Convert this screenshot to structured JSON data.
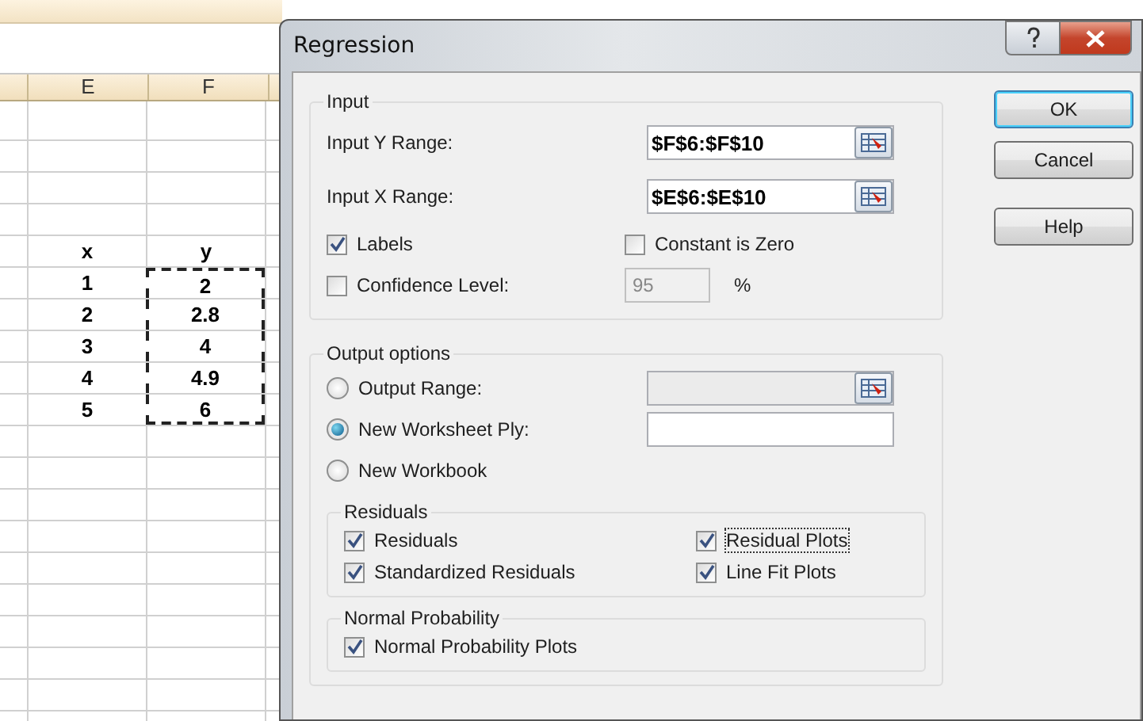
{
  "spreadsheet": {
    "columns": [
      "E",
      "F"
    ],
    "rows": [
      {
        "cells": [
          "x",
          "y"
        ],
        "marked": false
      },
      {
        "cells": [
          "1",
          "2"
        ],
        "marked": true
      },
      {
        "cells": [
          "2",
          "2.8"
        ],
        "marked": true
      },
      {
        "cells": [
          "3",
          "4"
        ],
        "marked": true
      },
      {
        "cells": [
          "4",
          "4.9"
        ],
        "marked": true
      },
      {
        "cells": [
          "5",
          "6"
        ],
        "marked": true
      }
    ]
  },
  "dialog": {
    "title": "Regression",
    "input": {
      "label": "Input",
      "ranges": [
        {
          "label": "Input Y Range:",
          "value": "$F$6:$F$10"
        },
        {
          "label": "Input X Range:",
          "value": "$E$6:$E$10"
        }
      ],
      "labels": {
        "label": "Labels",
        "checked": true
      },
      "constant_is_zero": {
        "label": "Constant is Zero",
        "checked": false
      },
      "confidence_level": {
        "label": "Confidence Level:",
        "checked": false,
        "value": "95",
        "unit": "%",
        "disabled": true
      }
    },
    "output": {
      "label": "Output options",
      "destinations": [
        {
          "label": "Output Range:",
          "selected": false,
          "field_disabled": true,
          "picker": true
        },
        {
          "label": "New Worksheet Ply:",
          "selected": true,
          "field_disabled": false,
          "picker": false
        },
        {
          "label": "New Workbook",
          "selected": false
        }
      ],
      "residuals": {
        "label": "Residuals",
        "items": [
          {
            "label": "Residuals",
            "checked": true,
            "focused": false
          },
          {
            "label": "Residual Plots",
            "checked": true,
            "focused": true
          },
          {
            "label": "Standardized Residuals",
            "checked": true,
            "focused": false
          },
          {
            "label": "Line Fit Plots",
            "checked": true,
            "focused": false
          }
        ]
      },
      "normal_probability": {
        "label": "Normal Probability",
        "items": [
          {
            "label": "Normal Probability Plots",
            "checked": true,
            "focused": false
          }
        ]
      }
    },
    "buttons": [
      {
        "label": "OK",
        "default": true
      },
      {
        "label": "Cancel",
        "default": false
      },
      {
        "label": "Help",
        "default": false
      }
    ]
  }
}
